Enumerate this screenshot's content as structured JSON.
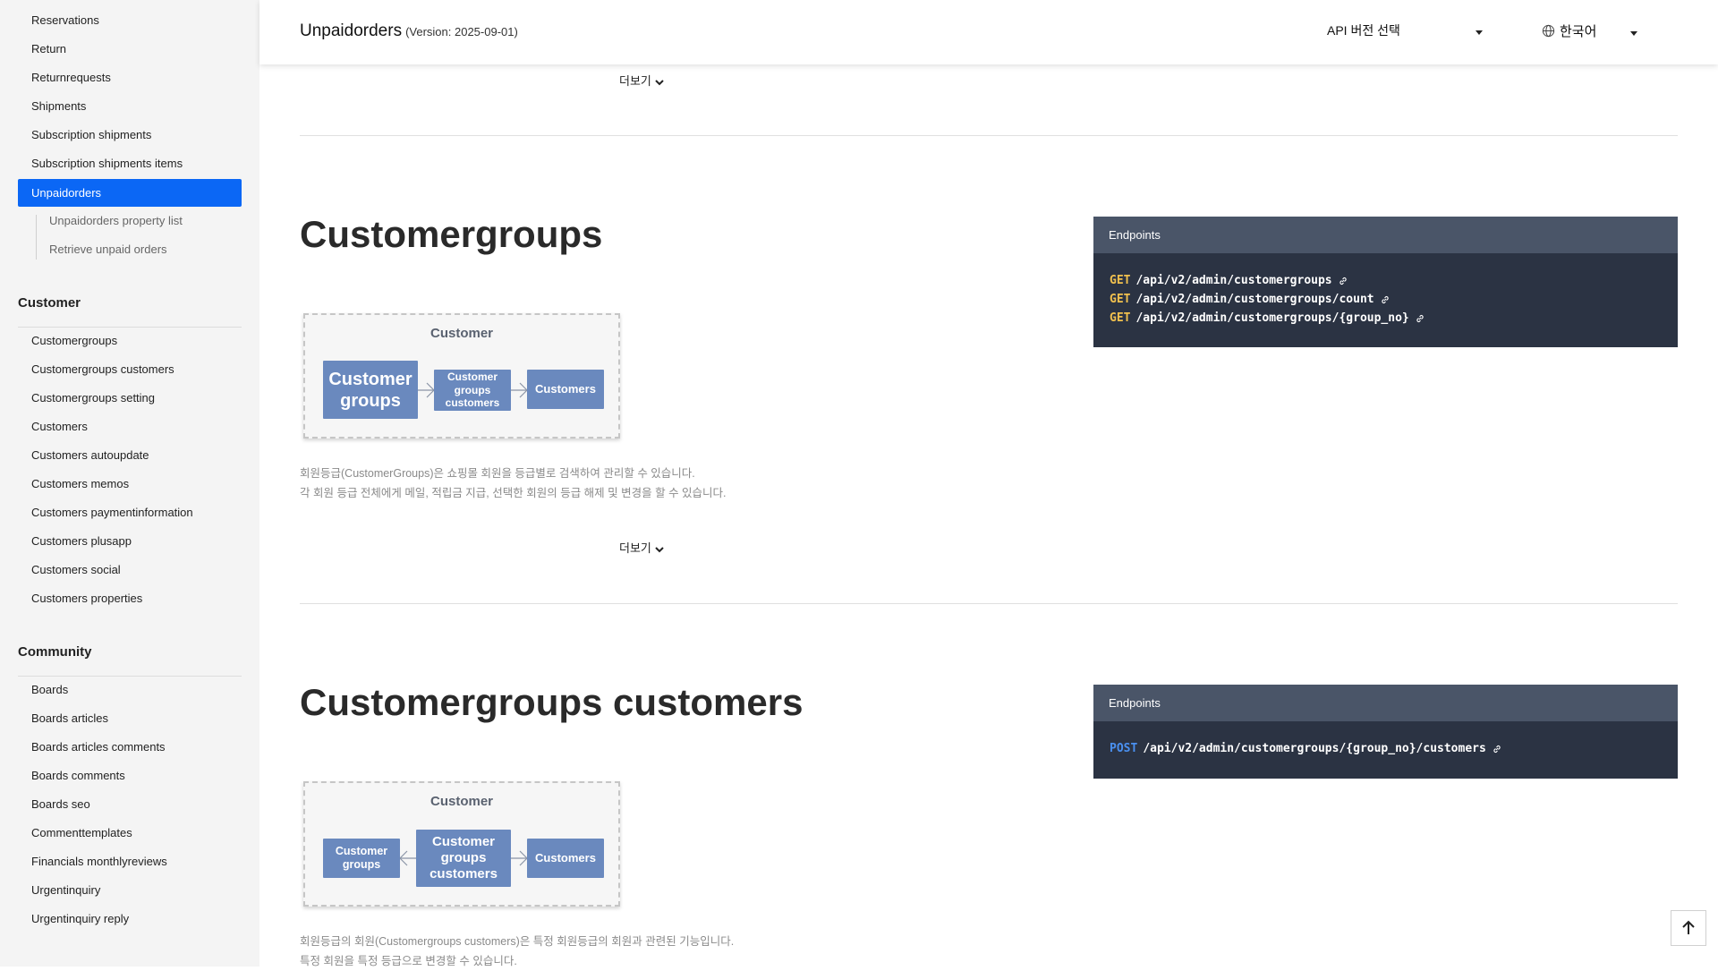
{
  "sidebar": {
    "items_top": [
      "Reservations",
      "Return",
      "Returnrequests",
      "Shipments",
      "Subscription shipments",
      "Subscription shipments items"
    ],
    "active_item": "Unpaidorders",
    "sub_items": [
      "Unpaidorders property list",
      "Retrieve unpaid orders"
    ],
    "sections": [
      {
        "title": "Customer",
        "items": [
          "Customergroups",
          "Customergroups customers",
          "Customergroups setting",
          "Customers",
          "Customers autoupdate",
          "Customers memos",
          "Customers paymentinformation",
          "Customers plusapp",
          "Customers social",
          "Customers properties"
        ]
      },
      {
        "title": "Community",
        "items": [
          "Boards",
          "Boards articles",
          "Boards articles comments",
          "Boards comments",
          "Boards seo",
          "Commenttemplates",
          "Financials monthlyreviews",
          "Urgentinquiry",
          "Urgentinquiry reply"
        ]
      }
    ]
  },
  "header": {
    "title": "Unpaidorders",
    "version": "(Version: 2025-09-01)",
    "api_select_label": "API 버전 선택",
    "language_label": "한국어"
  },
  "main": {
    "more_label": "더보기",
    "sections": [
      {
        "title": "Customergroups",
        "diagram": {
          "title": "Customer",
          "entities": [
            "Customer groups",
            "Customer groups customers",
            "Customers"
          ]
        },
        "description": [
          "회원등급(CustomerGroups)은 쇼핑몰 회원을 등급별로 검색하여 관리할 수 있습니다.",
          "각 회원 등급 전체에게 메일, 적립금 지급, 선택한 회원의 등급 해제 및 변경을 할 수 있습니다."
        ],
        "endpoints_label": "Endpoints",
        "endpoints": [
          {
            "method": "GET",
            "path": "/api/v2/admin/customergroups"
          },
          {
            "method": "GET",
            "path": "/api/v2/admin/customergroups/count"
          },
          {
            "method": "GET",
            "path": "/api/v2/admin/customergroups/{group_no}"
          }
        ]
      },
      {
        "title": "Customergroups customers",
        "diagram": {
          "title": "Customer",
          "entities": [
            "Customer groups",
            "Customer groups customers",
            "Customers"
          ]
        },
        "description": [
          "회원등급의 회원(Customergroups customers)은 특정 회원등급의 회원과 관련된 기능입니다.",
          "특정 회원을 특정 등급으로 변경할 수 있습니다."
        ],
        "endpoints_label": "Endpoints",
        "endpoints": [
          {
            "method": "POST",
            "path": "/api/v2/admin/customergroups/{group_no}/customers"
          }
        ]
      }
    ]
  },
  "icons": {
    "globe": "globe-icon",
    "caret": "caret-down-icon",
    "chevron": "chevron-down-icon",
    "link": "link-icon",
    "scroll_top": "arrow-up-icon"
  },
  "colors": {
    "active_nav": "#0b67f5",
    "entity": "#6a89be",
    "endpoint_bg": "#2b3343",
    "endpoint_header": "#4a5568",
    "get": "#f2c14e",
    "post": "#4a90f0"
  }
}
